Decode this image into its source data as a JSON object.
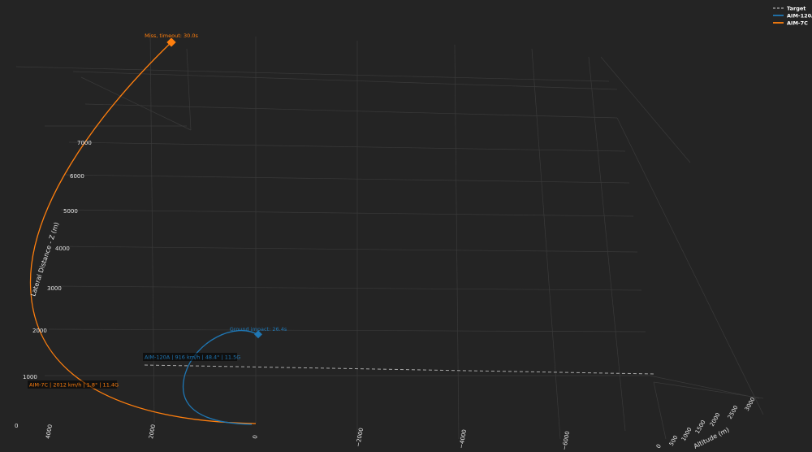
{
  "chart_data": {
    "type": "line",
    "subtype": "3d-trajectory",
    "background": "#242424",
    "grid": true,
    "legend_position": "top-right",
    "axes": {
      "x": {
        "title": "",
        "ticks": [
          "4000",
          "2000",
          "0",
          "−2000",
          "−4000",
          "−6000"
        ]
      },
      "y": {
        "title": "Altitude (m)",
        "ticks": [
          "0",
          "500",
          "1000",
          "1500",
          "2000",
          "2500",
          "3000"
        ]
      },
      "z": {
        "title": "Lateral Distance - Z (m)",
        "ticks": [
          "0",
          "1000",
          "2000",
          "3000",
          "4000",
          "5000",
          "6000",
          "7000"
        ]
      }
    },
    "series": [
      {
        "name": "Target",
        "color": "#aaaaaa",
        "dash": "dashed"
      },
      {
        "name": "AIM-120A",
        "color": "#1f77b4",
        "dash": "solid"
      },
      {
        "name": "AIM-7C",
        "color": "#ff7f0e",
        "dash": "solid"
      }
    ],
    "annotations": {
      "aim7_end": "Miss, timeout: 30.0s",
      "aim120_end": "Ground impact: 26.4s",
      "aim120_label": "AIM-120A | 916 km/h | 48.4° | 11.5G",
      "aim7_label": "AIM-7C | 2012 km/h | 1.8° | 11.4G"
    },
    "colors": {
      "aim120": "#1f77b4",
      "aim7": "#ff7f0e",
      "target": "#aaaaaa",
      "grid": "#3a3a3a"
    }
  }
}
